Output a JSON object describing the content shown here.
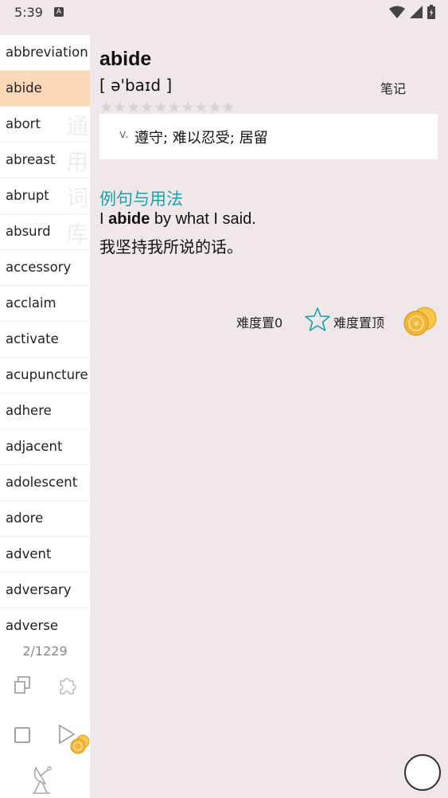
{
  "status_bar": {
    "time": "5:39",
    "badge": "A"
  },
  "sidebar": {
    "words": [
      "abbreviation",
      "abide",
      "abort",
      "abreast",
      "abrupt",
      "absurd",
      "accessory",
      "acclaim",
      "activate",
      "acupuncture",
      "adhere",
      "adjacent",
      "adolescent",
      "adore",
      "advent",
      "adversary",
      "adverse"
    ],
    "selected_index": 1,
    "watermark": [
      "通",
      "用",
      "词",
      "库"
    ],
    "counter": "2/1229",
    "tools": [
      "copy-icon",
      "puzzle-icon",
      "checkbox-icon",
      "play-icon",
      "coins-icon",
      "satellite-dish-icon"
    ]
  },
  "entry": {
    "headword": "abide",
    "phonetic": "[ ə'baɪd ]",
    "note_label": "笔记",
    "stars": {
      "total": 10,
      "filled": 0
    },
    "definition": {
      "pos": "v.",
      "text": "遵守; 难以忍受; 居留"
    },
    "examples_title": "例句与用法",
    "example_en": {
      "before": "I ",
      "bold": "abide",
      "after": " by what I said."
    },
    "example_zh": "我坚持我所说的话。"
  },
  "controls": {
    "reset_label": "难度置0",
    "top_label": "难度置顶"
  },
  "colors": {
    "accent": "#1aa0a8",
    "selected": "#fcd8b9",
    "background": "#f0e8e8"
  }
}
